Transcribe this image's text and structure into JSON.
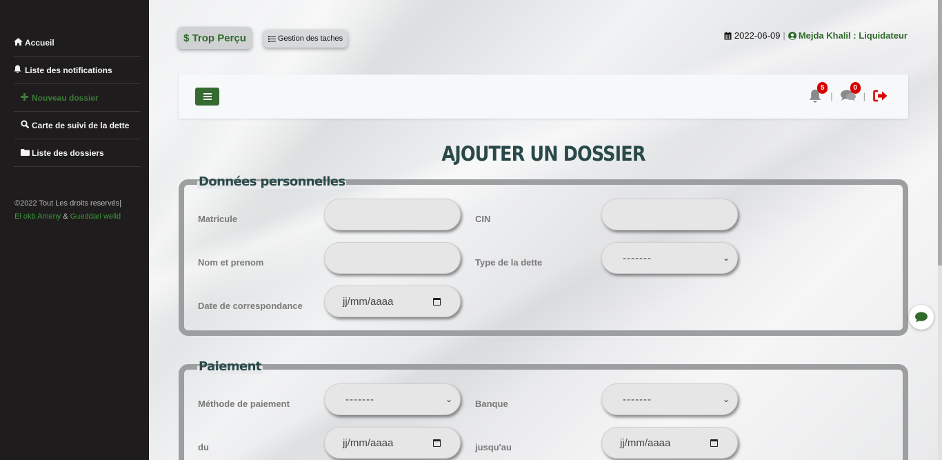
{
  "sidebar": {
    "items": [
      {
        "label": "Accueil",
        "icon": "home-icon"
      },
      {
        "label": "Liste des notifications",
        "icon": "bell-icon"
      },
      {
        "label": "Nouveau dossier",
        "icon": "plus-icon"
      },
      {
        "label": "Carte de suivi de la dette",
        "icon": "search-icon"
      },
      {
        "label": "Liste des dossiers",
        "icon": "folder-icon"
      }
    ],
    "copyright": "©2022 Tout Les droits reservés|",
    "author1": "El okb Ameny",
    "amp": "&",
    "author2": "Gueddari welid"
  },
  "topbar": {
    "brand": "$ Trop Perçu",
    "tasks": "Gestion des taches",
    "date": "2022-06-09",
    "user": "Mejda Khalil : Liquidateur"
  },
  "navbar": {
    "notif_count": "5",
    "msg_count": "0"
  },
  "page": {
    "title": "AJOUTER UN DOSSIER"
  },
  "personal": {
    "legend": "Données personnelles",
    "matricule_label": "Matricule",
    "cin_label": "CIN",
    "nom_label": "Nom et prenom",
    "type_label": "Type de la dette",
    "type_value": "-------",
    "date_label": "Date de correspondance",
    "date_placeholder": "jj/mm/aaaa"
  },
  "payment": {
    "legend": "Paiement",
    "methode_label": "Méthode de paiement",
    "methode_value": "-------",
    "banque_label": "Banque",
    "banque_value": "-------",
    "du_label": "du",
    "du_placeholder": "jj/mm/aaaa",
    "jusquau_label": "jusqu'au",
    "jusquau_placeholder": "jj/mm/aaaa"
  },
  "colors": {
    "brand_green": "#2f6a2b",
    "sidebar_bg": "#1e1c1c",
    "badge_red": "#d90000",
    "title_color": "#2a4a4a"
  }
}
